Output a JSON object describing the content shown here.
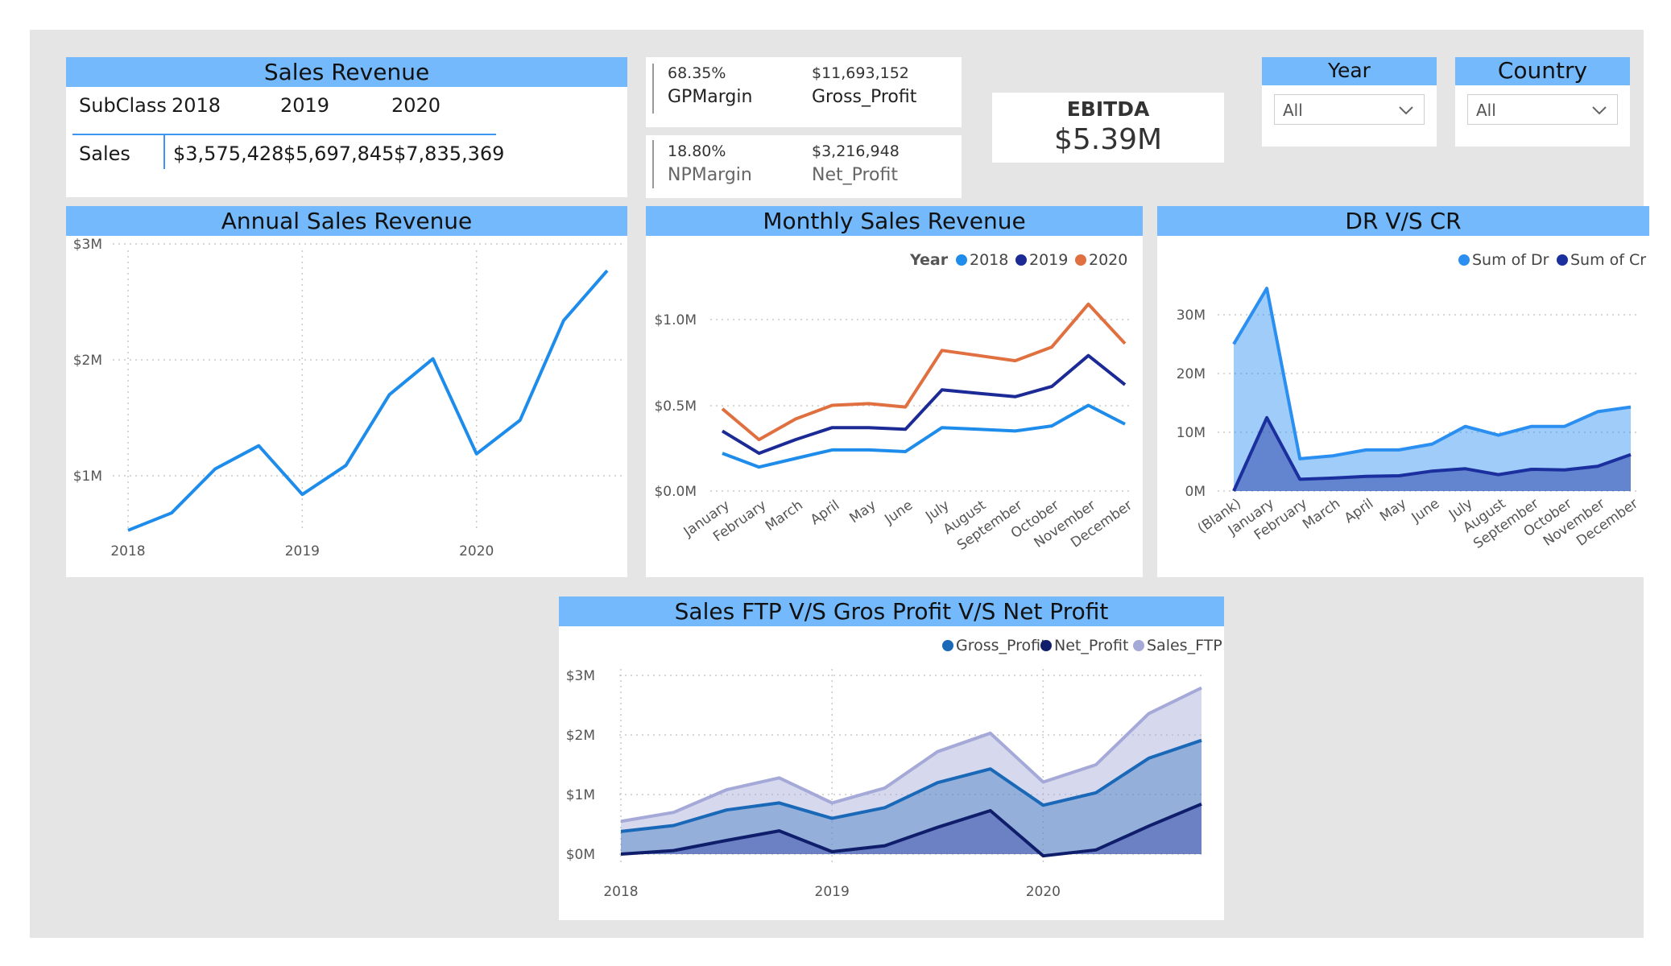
{
  "sales_revenue_table": {
    "title": "Sales Revenue",
    "headers": [
      "SubClass",
      "2018",
      "2019",
      "2020"
    ],
    "row_label": "Sales",
    "values": [
      "$3,575,428",
      "$5,697,845",
      "$7,835,369"
    ]
  },
  "kpi_cards": [
    {
      "pct": "68.35%",
      "pct_label": "GPMargin",
      "amount": "$11,693,152",
      "amount_label": "Gross_Profit"
    },
    {
      "pct": "18.80%",
      "pct_label": "NPMargin",
      "amount": "$3,216,948",
      "amount_label": "Net_Profit"
    }
  ],
  "ebitda": {
    "label": "EBITDA",
    "value": "$5.39M"
  },
  "slicers": [
    {
      "title": "Year",
      "value": "All"
    },
    {
      "title": "Country",
      "value": "All"
    }
  ],
  "colors": {
    "header_blue": "#74b9fb",
    "series_2018": "#1e8ceb",
    "series_2019": "#1c2a96",
    "series_2020": "#e07040",
    "dr": "#2a8ff0",
    "cr": "#1b2f9e",
    "gross": "#1a68b8",
    "net": "#0f1d6b",
    "ftp": "#a5a9d8"
  },
  "chart_data": [
    {
      "id": "annual",
      "type": "line",
      "title": "Annual Sales Revenue",
      "x_ticks": [
        "2018",
        "2019",
        "2020"
      ],
      "y_ticks": [
        "$1M",
        "$2M",
        "$3M"
      ],
      "ylim": [
        0.5,
        3.0
      ],
      "series": [
        {
          "values": [
            0.55,
            0.7,
            1.08,
            1.28,
            0.86,
            1.11,
            1.72,
            2.03,
            1.21,
            1.5,
            2.36,
            2.79
          ]
        }
      ],
      "grid": true
    },
    {
      "id": "monthly",
      "type": "line",
      "title": "Monthly Sales Revenue",
      "legend_title": "Year",
      "categories": [
        "January",
        "February",
        "March",
        "April",
        "May",
        "June",
        "July",
        "August",
        "September",
        "October",
        "November",
        "December"
      ],
      "y_ticks": [
        "$0.0M",
        "$0.5M",
        "$1.0M"
      ],
      "ylim": [
        0.0,
        1.0
      ],
      "series": [
        {
          "name": "2018",
          "values": [
            0.22,
            0.14,
            0.19,
            0.24,
            0.24,
            0.23,
            0.37,
            0.36,
            0.35,
            0.38,
            0.5,
            0.39
          ]
        },
        {
          "name": "2019",
          "values": [
            0.35,
            0.22,
            0.3,
            0.37,
            0.37,
            0.36,
            0.59,
            0.57,
            0.55,
            0.61,
            0.79,
            0.62
          ]
        },
        {
          "name": "2020",
          "values": [
            0.48,
            0.3,
            0.42,
            0.5,
            0.51,
            0.49,
            0.82,
            0.79,
            0.76,
            0.84,
            1.09,
            0.86
          ]
        }
      ],
      "legend_position": "top-right",
      "grid": true
    },
    {
      "id": "drcr",
      "type": "area",
      "title": "DR V/S CR",
      "categories": [
        "(Blank)",
        "January",
        "February",
        "March",
        "April",
        "May",
        "June",
        "July",
        "August",
        "September",
        "October",
        "November",
        "December"
      ],
      "y_ticks": [
        "0M",
        "10M",
        "20M",
        "30M"
      ],
      "ylim": [
        0,
        30
      ],
      "series": [
        {
          "name": "Sum of Dr",
          "values": [
            25,
            34.5,
            5.5,
            6,
            7,
            7,
            8,
            11,
            9.5,
            11,
            11,
            13.5,
            14.3
          ]
        },
        {
          "name": "Sum of Cr",
          "values": [
            0,
            12.5,
            2,
            2.2,
            2.5,
            2.6,
            3.4,
            3.8,
            2.8,
            3.7,
            3.6,
            4.2,
            6.2
          ]
        }
      ],
      "legend_position": "top-right",
      "grid": true
    },
    {
      "id": "profit",
      "type": "area",
      "title": "Sales FTP V/S Gros Profit V/S Net Profit",
      "x_ticks": [
        "2018",
        "2019",
        "2020"
      ],
      "y_ticks": [
        "$0M",
        "$1M",
        "$2M",
        "$3M"
      ],
      "ylim": [
        0,
        3
      ],
      "series": [
        {
          "name": "Gross_Profit",
          "values": [
            0.38,
            0.48,
            0.74,
            0.86,
            0.6,
            0.78,
            1.2,
            1.43,
            0.82,
            1.03,
            1.61,
            1.91
          ]
        },
        {
          "name": "Net_Profit",
          "values": [
            0.0,
            0.06,
            0.23,
            0.39,
            0.04,
            0.14,
            0.45,
            0.73,
            -0.03,
            0.07,
            0.47,
            0.84
          ]
        },
        {
          "name": "Sales_FTP",
          "values": [
            0.55,
            0.7,
            1.08,
            1.28,
            0.86,
            1.11,
            1.72,
            2.03,
            1.21,
            1.5,
            2.36,
            2.79
          ]
        }
      ],
      "legend_position": "top-right",
      "grid": true
    }
  ]
}
